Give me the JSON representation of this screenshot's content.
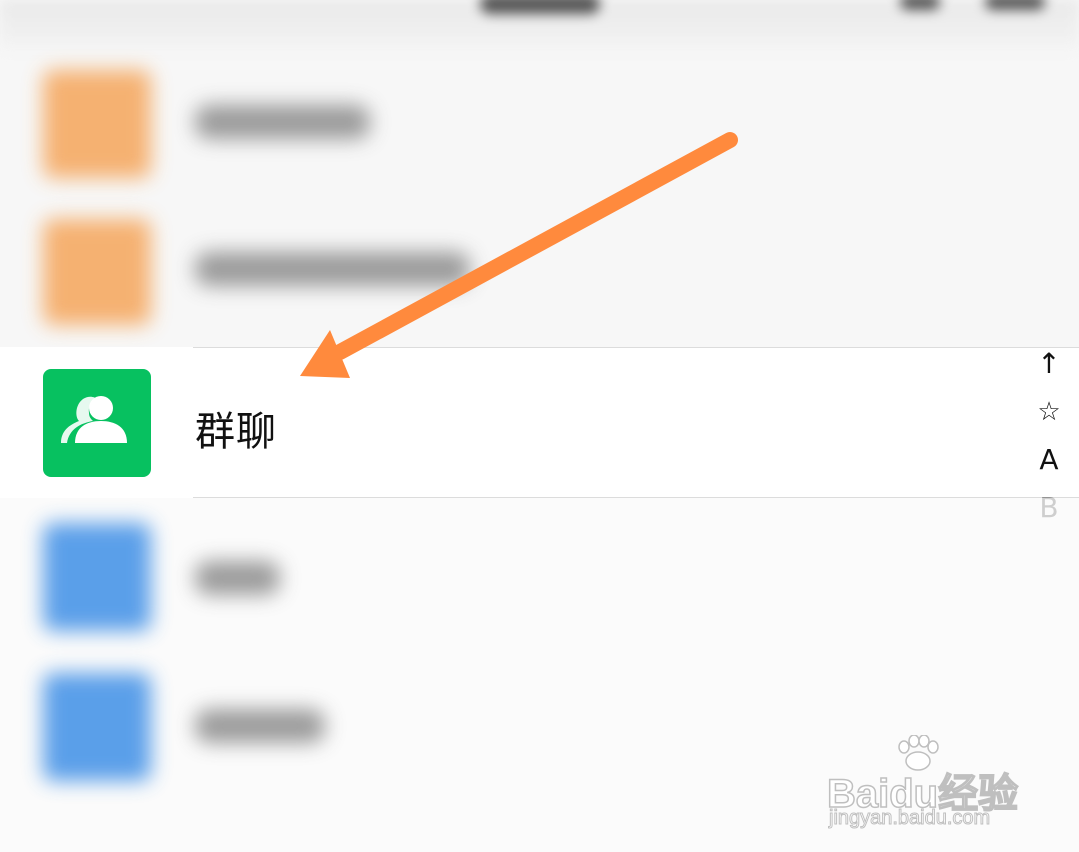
{
  "group_chat": {
    "label": "群聊"
  },
  "index_bar": {
    "items": [
      "↑",
      "☆",
      "A",
      "B"
    ]
  },
  "watermark": {
    "brand": "Baidu",
    "cn": "经验",
    "url": "jingyan.baidu.com"
  },
  "colors": {
    "accent_green": "#07c160",
    "arrow": "#ff8a3d",
    "orange_icon": "#f5a55a",
    "blue_icon": "#3f8fe6"
  }
}
